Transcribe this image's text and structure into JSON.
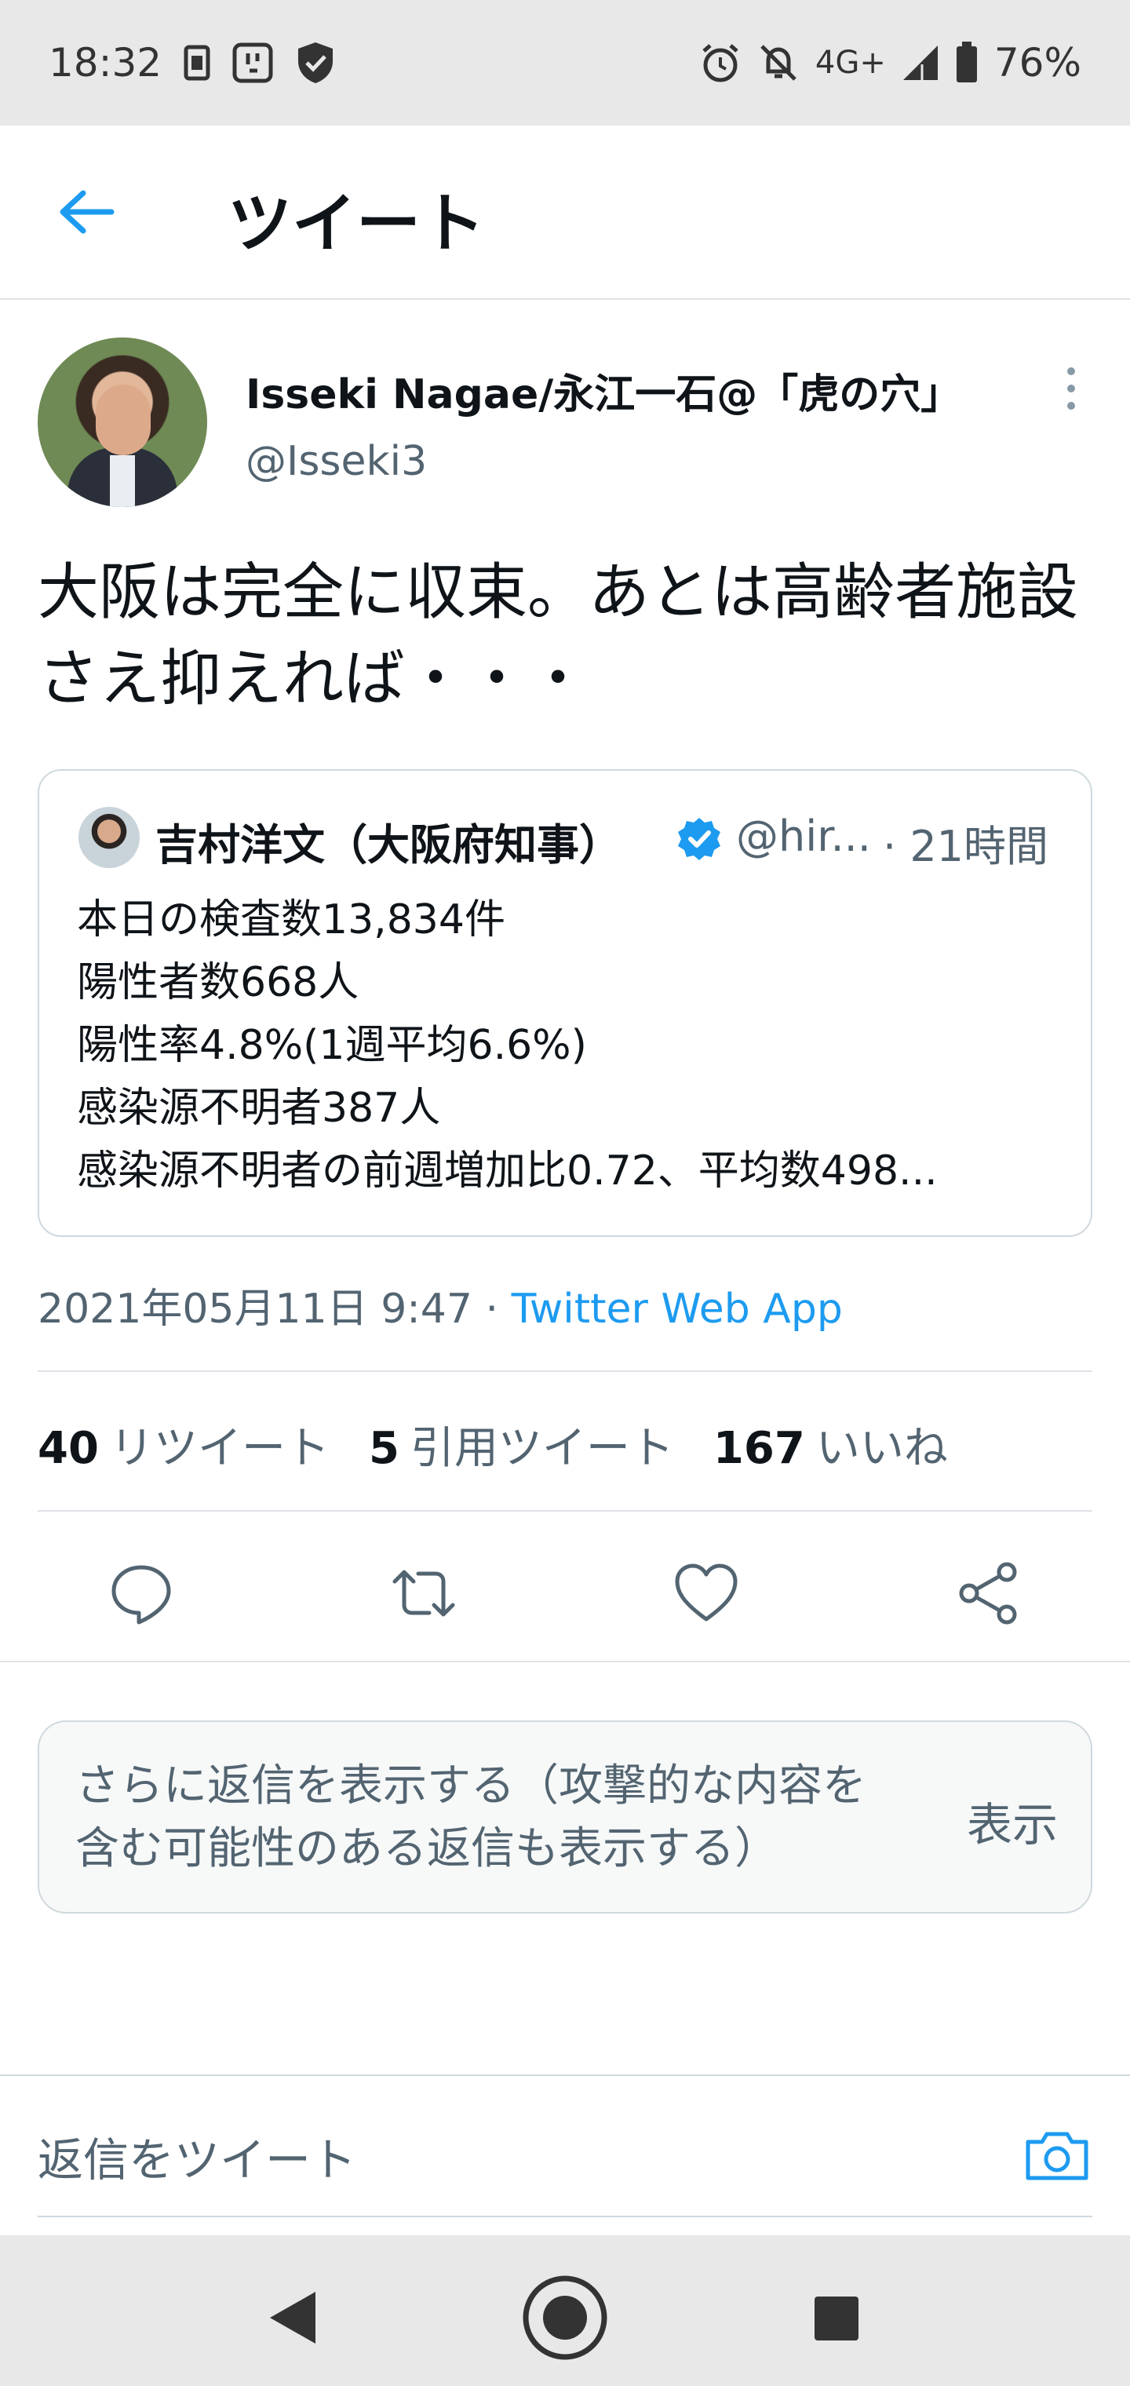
{
  "status_bar": {
    "time": "18:32",
    "network": "4G+",
    "battery": "76%",
    "icons": [
      "sim-card-icon",
      "notification-app-icon",
      "shield-icon",
      "alarm-icon",
      "notifications-off-icon",
      "signal-icon",
      "battery-icon"
    ]
  },
  "header": {
    "title": "ツイート",
    "back_icon": "arrow-left-icon",
    "accent_color": "#1d9bf0"
  },
  "author": {
    "display_name": "Isseki Nagae/永江一石@「虎の穴」",
    "handle": "@Isseki3"
  },
  "tweet": {
    "text": "大阪は完全に収束。あとは高齢者施設さえ抑えれば・・・",
    "timestamp": "2021年05月11日 9:47",
    "separator": " · ",
    "source": "Twitter Web App"
  },
  "quoted_tweet": {
    "name": "吉村洋文（大阪府知事）",
    "handle": "@hir...",
    "time": "· 21時間",
    "lines": [
      "本日の検査数13,834件",
      "陽性者数668人",
      "陽性率4.8%(1週平均6.6%)",
      "感染源不明者387人",
      "感染源不明者の前週増加比0.72、平均数498..."
    ]
  },
  "stats": {
    "retweets": {
      "count": "40",
      "label": "リツイート"
    },
    "quotes": {
      "count": "5",
      "label": "引用ツイート"
    },
    "likes": {
      "count": "167",
      "label": "いいね"
    }
  },
  "actions": [
    "reply-icon",
    "retweet-icon",
    "like-icon",
    "share-icon"
  ],
  "more_replies": {
    "text": "さらに返信を表示する（攻撃的な内容を含む可能性のある返信も表示する）",
    "button": "表示"
  },
  "reply": {
    "placeholder": "返信をツイート"
  },
  "nav": [
    "back-triangle-icon",
    "home-circle-icon",
    "recents-square-icon"
  ]
}
